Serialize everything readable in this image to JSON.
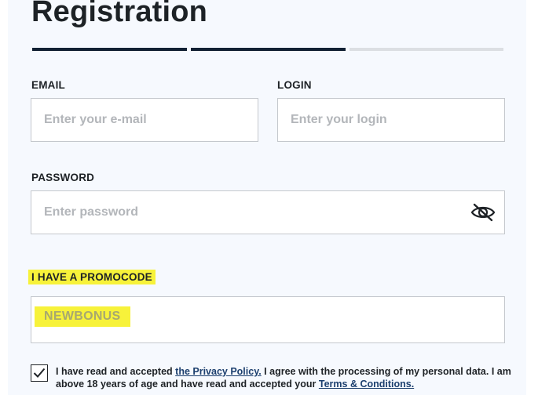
{
  "form": {
    "title": "Registration",
    "steps": [
      {
        "state": "complete"
      },
      {
        "state": "complete"
      },
      {
        "state": "pending"
      }
    ],
    "email": {
      "label": "EMAIL",
      "placeholder": "Enter your e-mail",
      "value": ""
    },
    "login": {
      "label": "LOGIN",
      "placeholder": "Enter your login",
      "value": ""
    },
    "password": {
      "label": "PASSWORD",
      "placeholder": "Enter password",
      "value": "",
      "toggle_icon": "eye-slash-icon"
    },
    "promocode": {
      "label": "I HAVE A PROMOCODE",
      "value": "NEWBONUS",
      "highlight_color": "#f7f23a"
    },
    "consent": {
      "checked": true,
      "text_1": "I have read and accepted ",
      "privacy_link": "the Privacy Policy.",
      "text_2": " I agree with the processing of my personal data. I am above 18 years of age and have read and accepted your ",
      "terms_link": "Terms & Conditions."
    }
  },
  "colors": {
    "progress_active": "#122134",
    "progress_inactive": "#dcdfe3",
    "panel_background": "#f6f9fe",
    "link": "#1c3f6e"
  }
}
